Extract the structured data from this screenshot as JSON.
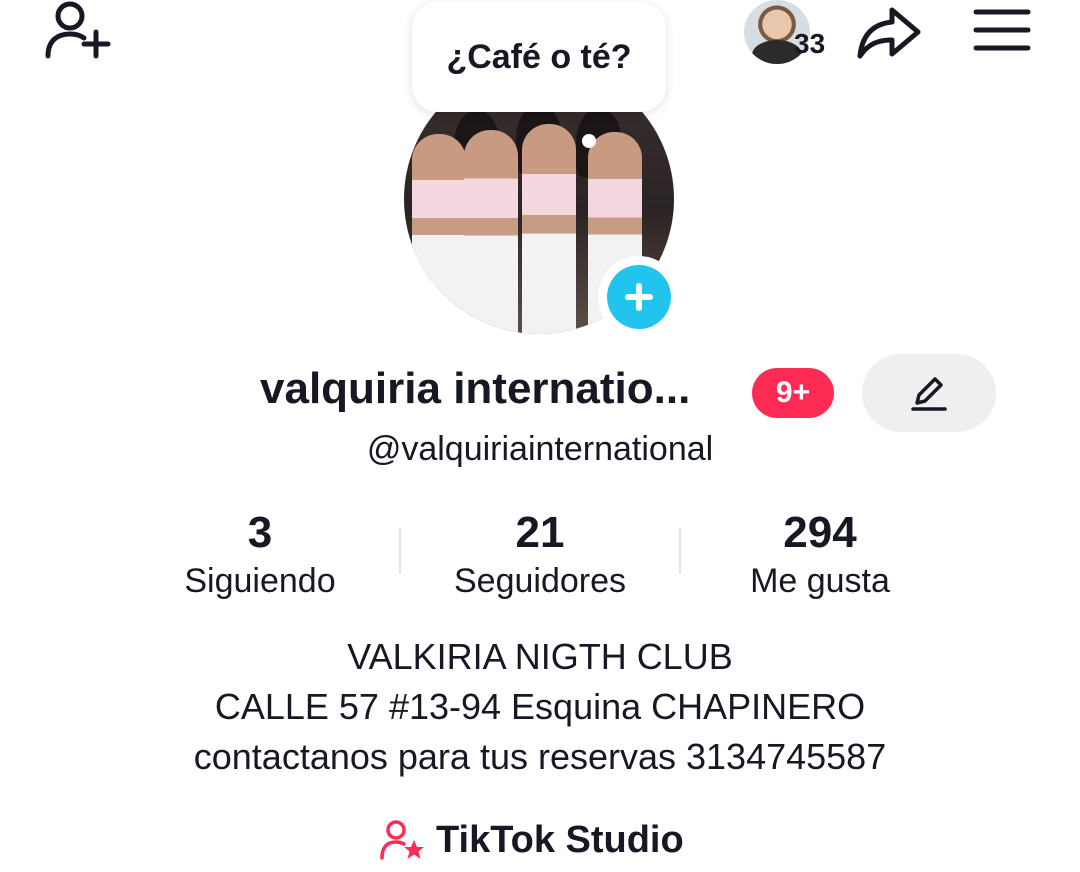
{
  "header": {
    "add_friend_icon": "person-plus-icon",
    "visitor_count": "33",
    "share_icon": "share-arrow-icon",
    "menu_icon": "hamburger-menu-icon"
  },
  "bubble": {
    "text": "¿Café o té?"
  },
  "profile": {
    "display_name": "valquiria internatio...",
    "notification_badge": "9+",
    "edit_icon": "pencil-icon",
    "username": "@valquiriainternational"
  },
  "stats": {
    "following": {
      "value": "3",
      "label": "Siguiendo"
    },
    "followers": {
      "value": "21",
      "label": "Seguidores"
    },
    "likes": {
      "value": "294",
      "label": "Me gusta"
    }
  },
  "bio": {
    "line1": "VALKIRIA NIGTH CLUB",
    "line2": "CALLE 57 #13-94 Esquina CHAPINERO",
    "line3": "contactanos para tus reservas 3134745587"
  },
  "studio": {
    "label": "TikTok Studio",
    "icon": "creator-star-icon"
  },
  "colors": {
    "accent": "#fe2c55",
    "add_button": "#20c4ec",
    "text": "#161823"
  }
}
